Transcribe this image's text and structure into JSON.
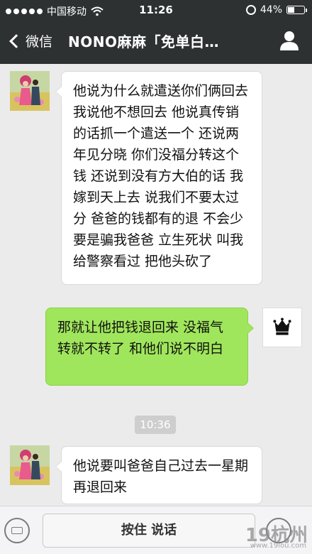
{
  "status_bar": {
    "carrier": "中国移动",
    "time": "11:26",
    "battery": "44%",
    "battery_level": 0.44
  },
  "nav": {
    "back_label": "微信",
    "title": "NONO麻麻「免单白…"
  },
  "messages": [
    {
      "side": "incoming",
      "text": "他说为什么就遣送你们俩回去 我说他不想回去 他说真传销的话抓一个遣送一个 还说两年见分晓 你们没福分转这个钱 还说到没有方大伯的话 我嫁到天上去 说我们不要太过分 爸爸的钱都有的退 不会少 要是骗我爸爸 立生死状 叫我给警察看过 把他头砍了"
    },
    {
      "side": "outgoing",
      "text": "那就让他把钱退回来 没福气转就不转了 和他们说不明白"
    },
    {
      "side": "incoming",
      "text": "他说要叫爸爸自己过去一星期再退回来"
    }
  ],
  "timestamp": "10:36",
  "input_bar": {
    "hold_to_talk": "按住 说话"
  },
  "watermark": {
    "text": "19杭州",
    "url": "www.19lou.com"
  },
  "colors": {
    "nav_bg": "#2e3132",
    "outgoing_bubble": "#a0e65c",
    "incoming_bubble": "#ffffff",
    "chat_bg": "#ebebeb"
  }
}
